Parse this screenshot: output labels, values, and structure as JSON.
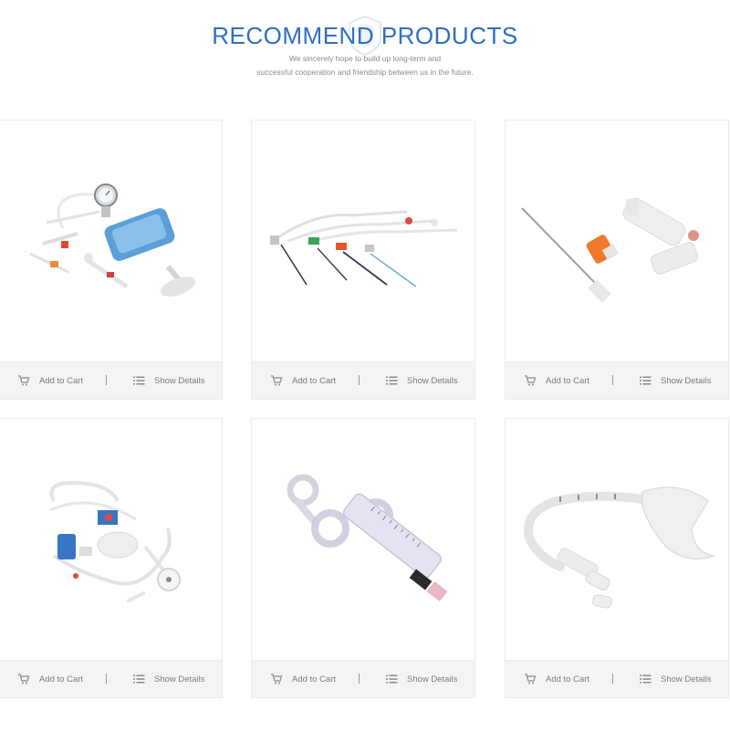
{
  "header": {
    "title": "RECOMMEND PRODUCTS",
    "subtitle_line1": "We sincerely hope to build up long-term and",
    "subtitle_line2": "successful cooperation and friendship between us in the future."
  },
  "actions": {
    "add_to_cart": "Add to Cart",
    "show_details": "Show Details"
  },
  "icons": {
    "cart": "cart-icon",
    "details": "list-icon"
  },
  "colors": {
    "title": "#2e6fc4",
    "bar_bg": "#f4f4f5",
    "action_text": "#7b7b7b"
  },
  "products": [
    {
      "image": "pressure-monitoring-kit-image"
    },
    {
      "image": "introducer-needles-image"
    },
    {
      "image": "y-connector-set-image"
    },
    {
      "image": "pressure-transducer-set-image"
    },
    {
      "image": "control-syringe-image"
    },
    {
      "image": "laryngeal-mask-airway-image"
    }
  ]
}
